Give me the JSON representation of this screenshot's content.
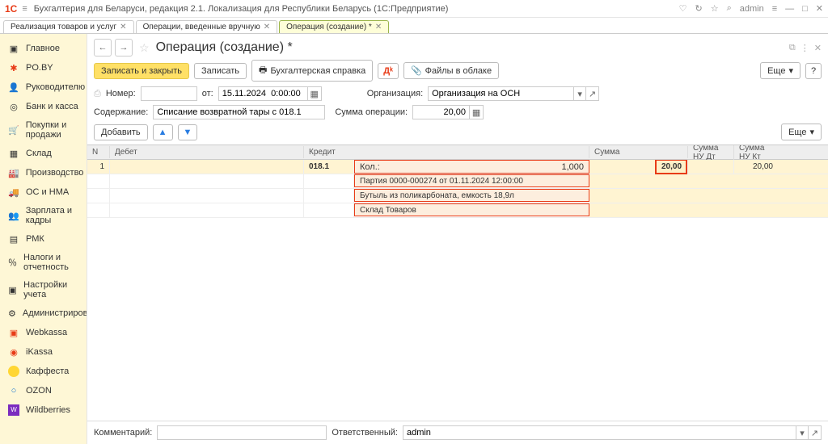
{
  "titlebar": {
    "app_title": "Бухгалтерия для Беларуси, редакция 2.1. Локализация для Республики Беларусь  (1С:Предприятие)",
    "user": "admin"
  },
  "tabs": {
    "t1": "Реализация товаров и услуг",
    "t2": "Операции, введенные вручную",
    "t3": "Операция (создание) *"
  },
  "sidebar": {
    "main": "Главное",
    "poby": "PO.BY",
    "manager": "Руководителю",
    "bank": "Банк и касса",
    "buy": "Покупки и продажи",
    "stock": "Склад",
    "prod": "Производство",
    "os": "ОС и НМА",
    "zp": "Зарплата и кадры",
    "rmk": "РМК",
    "tax": "Налоги и отчетность",
    "settings": "Настройки учета",
    "admin": "Администрирование",
    "web": "Webkassa",
    "ikassa": "iKassa",
    "kaff": "Каффеста",
    "ozon": "OZON",
    "wb": "Wildberries"
  },
  "header": {
    "page_title": "Операция (создание) *"
  },
  "toolbar": {
    "save_close": "Записать и закрыть",
    "save": "Записать",
    "print_ref": "Бухгалтерская справка",
    "files": "Файлы в облаке",
    "more": "Еще"
  },
  "form": {
    "number_lbl": "Номер:",
    "ot_lbl": "от:",
    "date_val": "15.11.2024  0:00:00",
    "org_lbl": "Организация:",
    "org_val": "Организация на ОСН",
    "content_lbl": "Содержание:",
    "content_val": "Списание возвратной тары с 018.1",
    "sum_lbl": "Сумма операции:",
    "sum_val": "20,00"
  },
  "subtoolbar": {
    "add": "Добавить",
    "more": "Еще"
  },
  "grid": {
    "h_n": "N",
    "h_debet": "Дебет",
    "h_kredit": "Кредит",
    "h_sum": "Сумма",
    "h_sumdt": "Сумма НУ Дт",
    "h_sumkt": "Сумма НУ Кт",
    "row": {
      "n": "1",
      "kredit": "018.1",
      "kol_lbl": "Кол.:",
      "kol_val": "1,000",
      "sum": "20,00",
      "sumkt": "20,00",
      "d1": "Партия 0000-000274 от 01.11.2024 12:00:00",
      "d2": "Бутыль из поликарбоната, емкость 18,9л",
      "d3": "Склад Товаров"
    }
  },
  "bottom": {
    "comment_lbl": "Комментарий:",
    "resp_lbl": "Ответственный:",
    "resp_val": "admin"
  }
}
